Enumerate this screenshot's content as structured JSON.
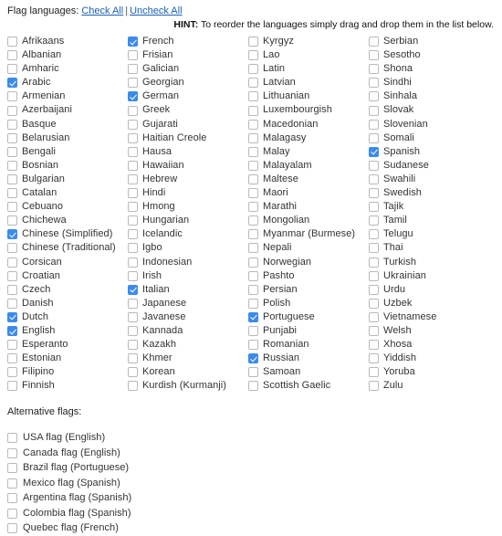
{
  "header": {
    "label": "Flag languages:",
    "check_all": "Check All",
    "separator": "|",
    "uncheck_all": "Uncheck All",
    "hint_prefix": "HINT:",
    "hint_text": "To reorder the languages simply drag and drop them in the list below."
  },
  "colors": {
    "link": "#1b61b3",
    "checkbox_checked": "#3b8beb",
    "checkbox_border": "#b9b9b9",
    "text": "#333333"
  },
  "languages": {
    "columns": [
      [
        {
          "label": "Afrikaans",
          "checked": false
        },
        {
          "label": "Albanian",
          "checked": false
        },
        {
          "label": "Amharic",
          "checked": false
        },
        {
          "label": "Arabic",
          "checked": true
        },
        {
          "label": "Armenian",
          "checked": false
        },
        {
          "label": "Azerbaijani",
          "checked": false
        },
        {
          "label": "Basque",
          "checked": false
        },
        {
          "label": "Belarusian",
          "checked": false
        },
        {
          "label": "Bengali",
          "checked": false
        },
        {
          "label": "Bosnian",
          "checked": false
        },
        {
          "label": "Bulgarian",
          "checked": false
        },
        {
          "label": "Catalan",
          "checked": false
        },
        {
          "label": "Cebuano",
          "checked": false
        },
        {
          "label": "Chichewa",
          "checked": false
        },
        {
          "label": "Chinese (Simplified)",
          "checked": true
        },
        {
          "label": "Chinese (Traditional)",
          "checked": false
        },
        {
          "label": "Corsican",
          "checked": false
        },
        {
          "label": "Croatian",
          "checked": false
        },
        {
          "label": "Czech",
          "checked": false
        },
        {
          "label": "Danish",
          "checked": false
        },
        {
          "label": "Dutch",
          "checked": true
        },
        {
          "label": "English",
          "checked": true
        },
        {
          "label": "Esperanto",
          "checked": false
        },
        {
          "label": "Estonian",
          "checked": false
        },
        {
          "label": "Filipino",
          "checked": false
        },
        {
          "label": "Finnish",
          "checked": false
        }
      ],
      [
        {
          "label": "French",
          "checked": true
        },
        {
          "label": "Frisian",
          "checked": false
        },
        {
          "label": "Galician",
          "checked": false
        },
        {
          "label": "Georgian",
          "checked": false
        },
        {
          "label": "German",
          "checked": true
        },
        {
          "label": "Greek",
          "checked": false
        },
        {
          "label": "Gujarati",
          "checked": false
        },
        {
          "label": "Haitian Creole",
          "checked": false
        },
        {
          "label": "Hausa",
          "checked": false
        },
        {
          "label": "Hawaiian",
          "checked": false
        },
        {
          "label": "Hebrew",
          "checked": false
        },
        {
          "label": "Hindi",
          "checked": false
        },
        {
          "label": "Hmong",
          "checked": false
        },
        {
          "label": "Hungarian",
          "checked": false
        },
        {
          "label": "Icelandic",
          "checked": false
        },
        {
          "label": "Igbo",
          "checked": false
        },
        {
          "label": "Indonesian",
          "checked": false
        },
        {
          "label": "Irish",
          "checked": false
        },
        {
          "label": "Italian",
          "checked": true
        },
        {
          "label": "Japanese",
          "checked": false
        },
        {
          "label": "Javanese",
          "checked": false
        },
        {
          "label": "Kannada",
          "checked": false
        },
        {
          "label": "Kazakh",
          "checked": false
        },
        {
          "label": "Khmer",
          "checked": false
        },
        {
          "label": "Korean",
          "checked": false
        },
        {
          "label": "Kurdish (Kurmanji)",
          "checked": false
        }
      ],
      [
        {
          "label": "Kyrgyz",
          "checked": false
        },
        {
          "label": "Lao",
          "checked": false
        },
        {
          "label": "Latin",
          "checked": false
        },
        {
          "label": "Latvian",
          "checked": false
        },
        {
          "label": "Lithuanian",
          "checked": false
        },
        {
          "label": "Luxembourgish",
          "checked": false
        },
        {
          "label": "Macedonian",
          "checked": false
        },
        {
          "label": "Malagasy",
          "checked": false
        },
        {
          "label": "Malay",
          "checked": false
        },
        {
          "label": "Malayalam",
          "checked": false
        },
        {
          "label": "Maltese",
          "checked": false
        },
        {
          "label": "Maori",
          "checked": false
        },
        {
          "label": "Marathi",
          "checked": false
        },
        {
          "label": "Mongolian",
          "checked": false
        },
        {
          "label": "Myanmar (Burmese)",
          "checked": false
        },
        {
          "label": "Nepali",
          "checked": false
        },
        {
          "label": "Norwegian",
          "checked": false
        },
        {
          "label": "Pashto",
          "checked": false
        },
        {
          "label": "Persian",
          "checked": false
        },
        {
          "label": "Polish",
          "checked": false
        },
        {
          "label": "Portuguese",
          "checked": true
        },
        {
          "label": "Punjabi",
          "checked": false
        },
        {
          "label": "Romanian",
          "checked": false
        },
        {
          "label": "Russian",
          "checked": true
        },
        {
          "label": "Samoan",
          "checked": false
        },
        {
          "label": "Scottish Gaelic",
          "checked": false
        }
      ],
      [
        {
          "label": "Serbian",
          "checked": false
        },
        {
          "label": "Sesotho",
          "checked": false
        },
        {
          "label": "Shona",
          "checked": false
        },
        {
          "label": "Sindhi",
          "checked": false
        },
        {
          "label": "Sinhala",
          "checked": false
        },
        {
          "label": "Slovak",
          "checked": false
        },
        {
          "label": "Slovenian",
          "checked": false
        },
        {
          "label": "Somali",
          "checked": false
        },
        {
          "label": "Spanish",
          "checked": true
        },
        {
          "label": "Sudanese",
          "checked": false
        },
        {
          "label": "Swahili",
          "checked": false
        },
        {
          "label": "Swedish",
          "checked": false
        },
        {
          "label": "Tajik",
          "checked": false
        },
        {
          "label": "Tamil",
          "checked": false
        },
        {
          "label": "Telugu",
          "checked": false
        },
        {
          "label": "Thai",
          "checked": false
        },
        {
          "label": "Turkish",
          "checked": false
        },
        {
          "label": "Ukrainian",
          "checked": false
        },
        {
          "label": "Urdu",
          "checked": false
        },
        {
          "label": "Uzbek",
          "checked": false
        },
        {
          "label": "Vietnamese",
          "checked": false
        },
        {
          "label": "Welsh",
          "checked": false
        },
        {
          "label": "Xhosa",
          "checked": false
        },
        {
          "label": "Yiddish",
          "checked": false
        },
        {
          "label": "Yoruba",
          "checked": false
        },
        {
          "label": "Zulu",
          "checked": false
        }
      ]
    ]
  },
  "alternative_flags": {
    "title": "Alternative flags:",
    "items": [
      {
        "label": "USA flag (English)",
        "checked": false
      },
      {
        "label": "Canada flag (English)",
        "checked": false
      },
      {
        "label": "Brazil flag (Portuguese)",
        "checked": false
      },
      {
        "label": "Mexico flag (Spanish)",
        "checked": false
      },
      {
        "label": "Argentina flag (Spanish)",
        "checked": false
      },
      {
        "label": "Colombia flag (Spanish)",
        "checked": false
      },
      {
        "label": "Quebec flag (French)",
        "checked": false
      }
    ]
  }
}
